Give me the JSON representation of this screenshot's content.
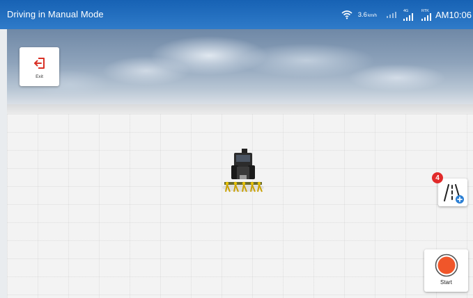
{
  "status_bar": {
    "title": "Driving in Manual Mode",
    "speed_value": "3.6",
    "speed_unit": "km/h",
    "network_label": "4G",
    "rtk_label": "RTK",
    "time": "AM10:06",
    "color": "#1f6dbf"
  },
  "exit_button": {
    "label": "Exit",
    "icon": "exit-arrow-icon",
    "color": "#d93025"
  },
  "guidance_button": {
    "badge_count": "4",
    "icon": "guidance-line-add-icon",
    "badge_color": "#e12a2a"
  },
  "start_button": {
    "label": "Start",
    "icon": "record-start-icon",
    "color": "#f0562a"
  },
  "scene": {
    "vehicle": "tractor-icon"
  }
}
